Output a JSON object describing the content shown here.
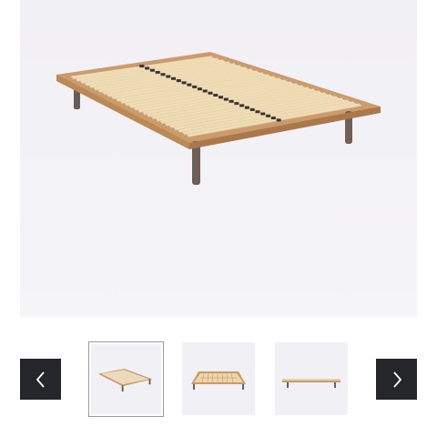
{
  "gallery": {
    "main_image": {
      "subject": "bed-frame-slatted-base",
      "icon": "product-photo"
    },
    "prev_button": {
      "icon": "chevron-left-icon"
    },
    "next_button": {
      "icon": "chevron-right-icon"
    },
    "thumbnails": [
      {
        "view": "angled",
        "selected": true
      },
      {
        "view": "top",
        "selected": false
      },
      {
        "view": "side",
        "selected": false
      }
    ],
    "colors": {
      "nav_bg": "#25262a",
      "nav_icon": "#ffffff",
      "frame_wood": "#c9986a",
      "slat": "#efdcb5",
      "leg": "#6f5f57",
      "photo_bg": "#f2f1f5",
      "selected_border": "#9a9a9a"
    }
  }
}
